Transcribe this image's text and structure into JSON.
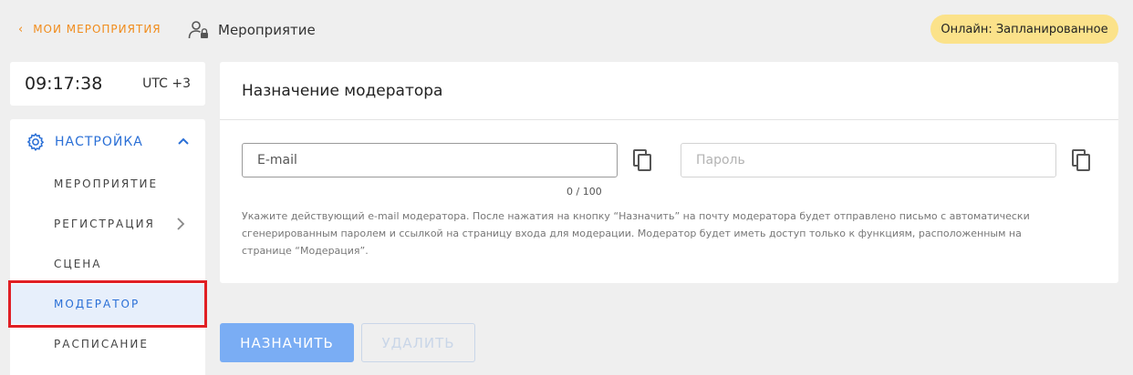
{
  "header": {
    "back_label": "МОИ МЕРОПРИЯТИЯ",
    "crumb_label": "Мероприятие",
    "status_badge": "Онлайн: Запланированное"
  },
  "clock": {
    "time": "09:17:38",
    "timezone": "UTC +3"
  },
  "sidebar": {
    "section_label": "НАСТРОЙКА",
    "items": [
      {
        "label": "МЕРОПРИЯТИЕ"
      },
      {
        "label": "РЕГИСТРАЦИЯ"
      },
      {
        "label": "СЦЕНА"
      },
      {
        "label": "МОДЕРАТОР"
      },
      {
        "label": "РАСПИСАНИЕ"
      }
    ],
    "active_item": "МОДЕРАТОР"
  },
  "main": {
    "title": "Назначение модератора",
    "email_placeholder": "E-mail",
    "email_value": "",
    "password_placeholder": "Пароль",
    "password_value": "",
    "counter": "0 / 100",
    "help_text": "Укажите действующий e-mail модератора. После нажатия на кнопку “Назначить” на почту модератора будет отправлено письмо с автоматически сгенерированным паролем и ссылкой на страницу входа для модерации. Модератор будет иметь доступ только к функциям, расположенным на странице “Модерация”."
  },
  "actions": {
    "assign_label": "НАЗНАЧИТЬ",
    "delete_label": "УДАЛИТЬ"
  },
  "colors": {
    "accent": "#2a6fd6",
    "back_link": "#f08c1c",
    "badge": "#fbe28a",
    "assign_button": "#7aadf4",
    "highlight": "#e01f24"
  },
  "icons": {
    "back": "chevron-left-icon",
    "crumb": "user-lock-icon",
    "section": "gear-icon",
    "collapse": "chevron-up-icon",
    "submenu": "chevron-right-icon",
    "copy": "copy-icon"
  }
}
